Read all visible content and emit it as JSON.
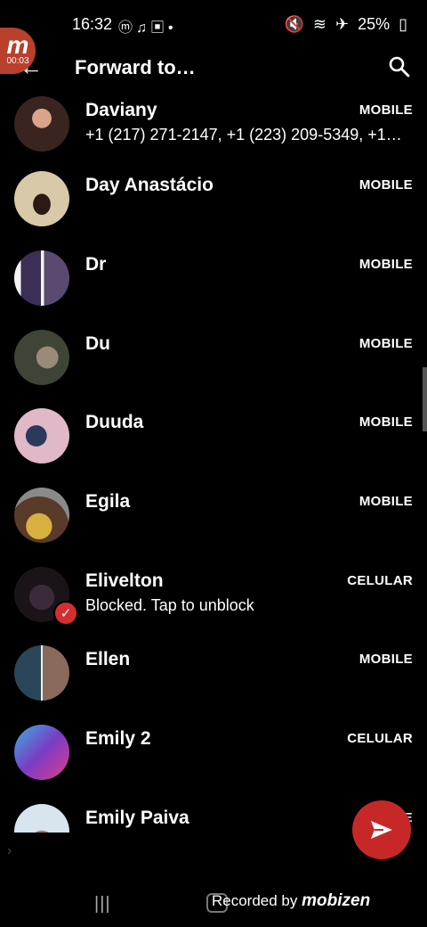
{
  "status_bar": {
    "time": "16:32",
    "battery": "25%",
    "recording_elapsed": "00:03"
  },
  "app_bar": {
    "title": "Forward to…"
  },
  "contacts": [
    {
      "name": "Daviany",
      "type": "MOBILE",
      "subtitle": "+1 (217) 271-2147, +1 (223) 209-5349, +1…",
      "avatar_color": "#6b4a3c"
    },
    {
      "name": "Day Anastácio",
      "type": "MOBILE",
      "subtitle": "",
      "avatar_color": "#c9b98f"
    },
    {
      "name": "Dr",
      "type": "MOBILE",
      "subtitle": "",
      "avatar_color": "#2c2a4a"
    },
    {
      "name": "Du",
      "type": "MOBILE",
      "subtitle": "",
      "avatar_color": "#4b4e3c"
    },
    {
      "name": "Duuda",
      "type": "MOBILE",
      "subtitle": "",
      "avatar_color": "#c4869c"
    },
    {
      "name": "Egila",
      "type": "MOBILE",
      "subtitle": "",
      "avatar_color": "#7a5a3a"
    },
    {
      "name": "Elivelton",
      "type": "CELULAR",
      "subtitle": "Blocked. Tap to unblock",
      "avatar_color": "#2a2230"
    },
    {
      "name": "Ellen",
      "type": "MOBILE",
      "subtitle": "",
      "avatar_color": "#3c4f5a"
    },
    {
      "name": "Emily 2",
      "type": "CELULAR",
      "subtitle": "",
      "avatar_color": "#7a3cc4"
    },
    {
      "name": "Emily Paiva",
      "type": "MOBILE",
      "subtitle": "",
      "avatar_color": "#c7d4e0"
    }
  ],
  "watermark": {
    "prefix": "Recorded by",
    "brand": "mobizen"
  },
  "colors": {
    "background": "#000000",
    "fab": "#c62828",
    "blocked_badge": "#d32f2f"
  }
}
